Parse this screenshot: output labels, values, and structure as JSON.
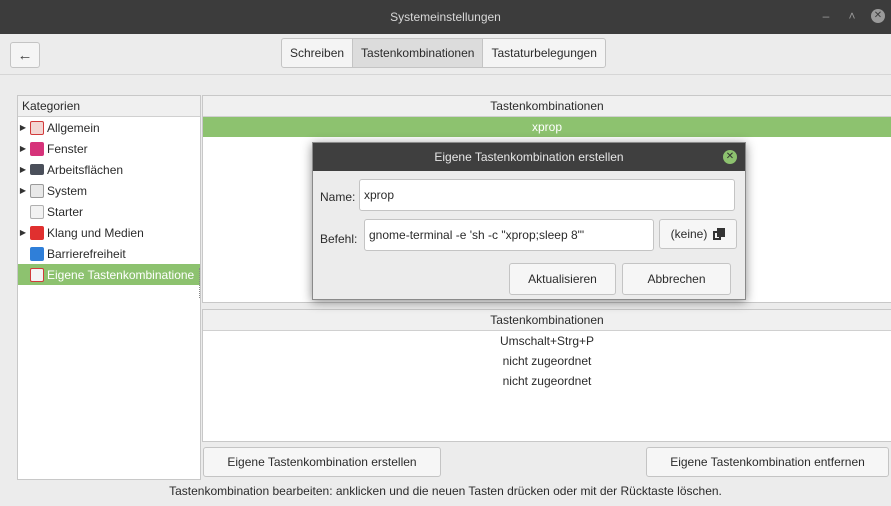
{
  "window": {
    "title": "Systemeinstellungen"
  },
  "tabs": [
    {
      "label": "Schreiben"
    },
    {
      "label": "Tastenkombinationen",
      "active": true
    },
    {
      "label": "Tastaturbelegungen"
    }
  ],
  "categories": {
    "header": "Kategorien",
    "items": [
      {
        "label": "Allgemein",
        "icon": "general-icon",
        "expandable": true
      },
      {
        "label": "Fenster",
        "icon": "window-icon",
        "expandable": true
      },
      {
        "label": "Arbeitsflächen",
        "icon": "workspace-icon",
        "expandable": true
      },
      {
        "label": "System",
        "icon": "system-icon",
        "expandable": true
      },
      {
        "label": "Starter",
        "icon": "starter-icon",
        "expandable": false
      },
      {
        "label": "Klang und Medien",
        "icon": "media-icon",
        "expandable": true
      },
      {
        "label": "Barrierefreiheit",
        "icon": "accessibility-icon",
        "expandable": false
      },
      {
        "label": "Eigene Tastenkombinatione",
        "icon": "custom-shortcut-icon",
        "expandable": false,
        "selected": true
      }
    ]
  },
  "shortcuts": {
    "header": "Tastenkombinationen",
    "items": [
      {
        "label": "xprop",
        "selected": true
      }
    ]
  },
  "bindings": {
    "header": "Tastenkombinationen",
    "items": [
      "Umschalt+Strg+P",
      "nicht zugeordnet",
      "nicht zugeordnet"
    ]
  },
  "actions": {
    "create_label": "Eigene Tastenkombination erstellen",
    "remove_label": "Eigene Tastenkombination entfernen"
  },
  "status_text": "Tastenkombination bearbeiten: anklicken und die neuen Tasten drücken oder mit der Rücktaste löschen.",
  "dialog": {
    "title": "Eigene Tastenkombination erstellen",
    "name_label": "Name:",
    "name_value": "xprop",
    "command_label": "Befehl:",
    "command_value": "gnome-terminal -e 'sh -c \"xprop;sleep 8\"'",
    "keine_label": "(keine)",
    "update_label": "Aktualisieren",
    "cancel_label": "Abbrechen"
  },
  "colors": {
    "accent": "#8dc26f",
    "titlebar": "#3c3c3c"
  }
}
